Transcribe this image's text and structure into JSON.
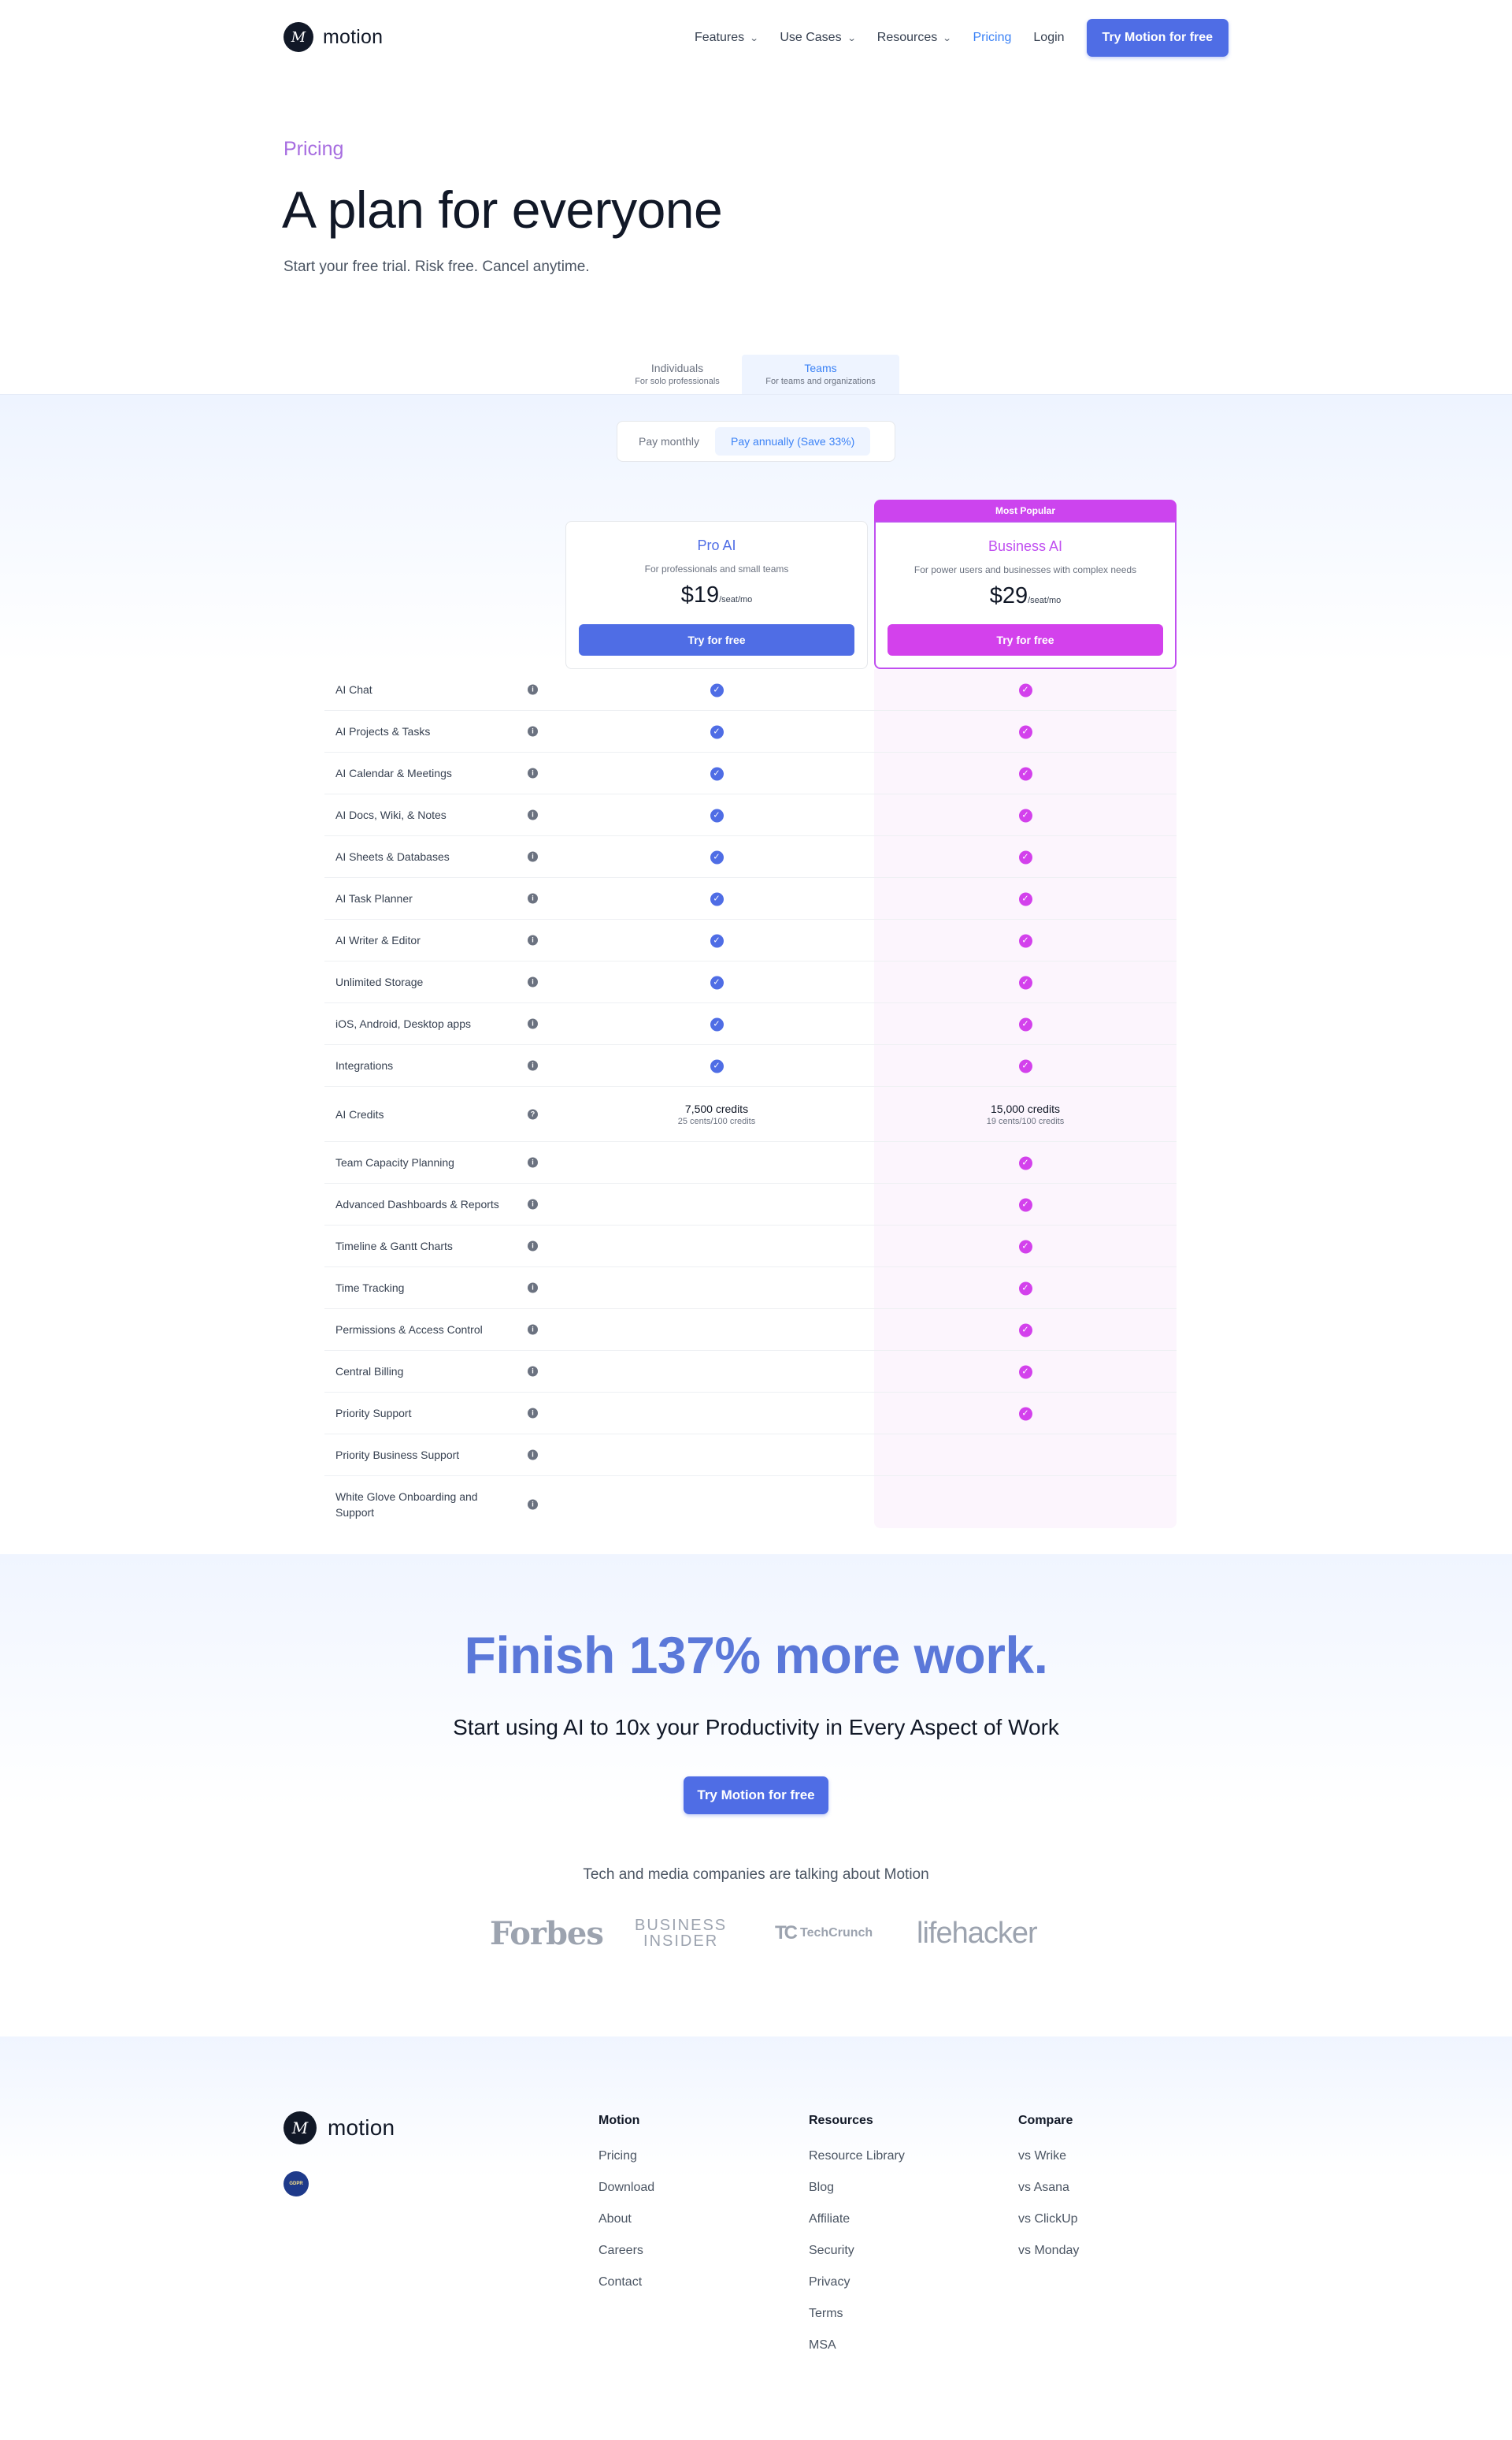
{
  "nav": {
    "logo_text": "motion",
    "logo_glyph": "M",
    "items": [
      {
        "label": "Features",
        "dropdown": true
      },
      {
        "label": "Use Cases",
        "dropdown": true
      },
      {
        "label": "Resources",
        "dropdown": true
      },
      {
        "label": "Pricing",
        "dropdown": false,
        "active": true
      },
      {
        "label": "Login",
        "dropdown": false
      }
    ],
    "cta": "Try Motion for free"
  },
  "hero": {
    "eyebrow": "Pricing",
    "title": "A plan for everyone",
    "subtitle": "Start your free trial. Risk free. Cancel anytime."
  },
  "plan_tabs": [
    {
      "label": "Individuals",
      "sub": "For solo professionals",
      "active": false
    },
    {
      "label": "Teams",
      "sub": "For teams and organizations",
      "active": true
    }
  ],
  "billing": {
    "monthly": "Pay monthly",
    "annual": "Pay annually (Save 33%)",
    "selected": "annual"
  },
  "plans": {
    "pro": {
      "name": "Pro AI",
      "description": "For professionals and small teams",
      "price": "$19",
      "unit": "/seat/mo",
      "button": "Try for free"
    },
    "business": {
      "badge": "Most Popular",
      "name": "Business AI",
      "description": "For power users and businesses with complex needs",
      "price": "$29",
      "unit": "/seat/mo",
      "button": "Try for free"
    }
  },
  "features": [
    {
      "name": "AI Chat",
      "pro": true,
      "business": true
    },
    {
      "name": "AI Projects & Tasks",
      "pro": true,
      "business": true
    },
    {
      "name": "AI Calendar & Meetings",
      "pro": true,
      "business": true
    },
    {
      "name": "AI Docs, Wiki, & Notes",
      "pro": true,
      "business": true
    },
    {
      "name": "AI Sheets & Databases",
      "pro": true,
      "business": true
    },
    {
      "name": "AI Task Planner",
      "pro": true,
      "business": true
    },
    {
      "name": "AI Writer & Editor",
      "pro": true,
      "business": true
    },
    {
      "name": "Unlimited Storage",
      "pro": true,
      "business": true
    },
    {
      "name": "iOS, Android, Desktop apps",
      "pro": true,
      "business": true
    },
    {
      "name": "Integrations",
      "pro": true,
      "business": true
    },
    {
      "name": "AI Credits",
      "pro": {
        "main": "7,500 credits",
        "sub": "25 cents/100 credits"
      },
      "business": {
        "main": "15,000 credits",
        "sub": "19 cents/100 credits"
      },
      "info_icon": "question-icon"
    },
    {
      "name": "Team Capacity Planning",
      "pro": false,
      "business": true
    },
    {
      "name": "Advanced Dashboards & Reports",
      "pro": false,
      "business": true
    },
    {
      "name": "Timeline & Gantt Charts",
      "pro": false,
      "business": true
    },
    {
      "name": "Time Tracking",
      "pro": false,
      "business": true
    },
    {
      "name": "Permissions & Access Control",
      "pro": false,
      "business": true
    },
    {
      "name": "Central Billing",
      "pro": false,
      "business": true
    },
    {
      "name": "Priority Support",
      "pro": false,
      "business": true
    },
    {
      "name": "Priority Business Support",
      "pro": false,
      "business": false
    },
    {
      "name": "White Glove Onboarding and Support",
      "pro": false,
      "business": false
    }
  ],
  "cta": {
    "title": "Finish 137% more work.",
    "subtitle": "Start using AI to 10x your Productivity in Every Aspect of Work",
    "button": "Try Motion for free",
    "press_title": "Tech and media companies are talking about Motion",
    "press": {
      "forbes": "Forbes",
      "bi_line1": "BUSINESS",
      "bi_line2": "INSIDER",
      "techcrunch": "TechCrunch",
      "techcrunch_mark": "TC",
      "lifehacker": "lifehacker"
    }
  },
  "footer": {
    "logo_text": "motion",
    "logo_glyph": "M",
    "badge": "GDPR",
    "columns": [
      {
        "title": "Motion",
        "links": [
          "Pricing",
          "Download",
          "About",
          "Careers",
          "Contact"
        ]
      },
      {
        "title": "Resources",
        "links": [
          "Resource Library",
          "Blog",
          "Affiliate",
          "Security",
          "Privacy",
          "Terms",
          "MSA"
        ]
      },
      {
        "title": "Compare",
        "links": [
          "vs Wrike",
          "vs Asana",
          "vs ClickUp",
          "vs Monday"
        ]
      }
    ]
  },
  "colors": {
    "brand_blue": "#4f6de5",
    "brand_magenta": "#d341ec",
    "eyebrow_purple": "#a76de0",
    "cta_title_blue": "#5b78d9"
  }
}
